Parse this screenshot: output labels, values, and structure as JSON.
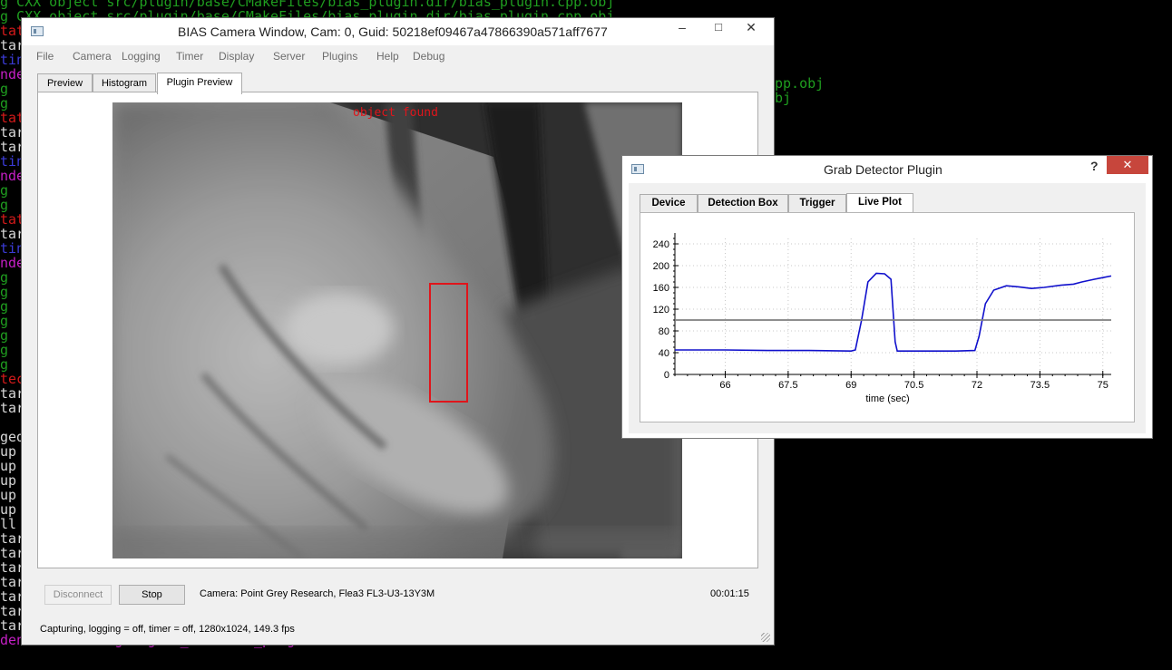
{
  "terminal": {
    "lines": [
      {
        "text": "g CXX object src/plugin/base/CMakeFiles/bias_plugin.dir/bias_plugin.cpp.obj",
        "cls": "tg"
      },
      {
        "text": "g CXX object src/plugin/base/CMakeFiles/bias_plugin.dir/bias_plugin.cpp.obj",
        "cls": "tg"
      },
      {
        "text": "tat",
        "cls": "tr"
      },
      {
        "text": "tar",
        "cls": "tw"
      },
      {
        "text": "tin",
        "cls": "tb"
      },
      {
        "text": "nde",
        "cls": "tm"
      },
      {
        "text": "g",
        "cls": "tg"
      },
      {
        "text": "g",
        "cls": "tg"
      },
      {
        "text": "tat",
        "cls": "tr"
      },
      {
        "text": "tar",
        "cls": "tw"
      },
      {
        "text": "tar",
        "cls": "tw"
      },
      {
        "text": "tin",
        "cls": "tb"
      },
      {
        "text": "nde",
        "cls": "tm"
      },
      {
        "text": "g",
        "cls": "tg"
      },
      {
        "text": "g",
        "cls": "tg"
      },
      {
        "text": "tat",
        "cls": "tr"
      },
      {
        "text": "tar",
        "cls": "tw"
      },
      {
        "text": "tin",
        "cls": "tb"
      },
      {
        "text": "nde",
        "cls": "tm"
      },
      {
        "text": "g",
        "cls": "tg"
      },
      {
        "text": "g",
        "cls": "tg"
      },
      {
        "text": "g",
        "cls": "tg"
      },
      {
        "text": "g",
        "cls": "tg"
      },
      {
        "text": "g",
        "cls": "tg"
      },
      {
        "text": "g",
        "cls": "tg"
      },
      {
        "text": "g",
        "cls": "tg"
      },
      {
        "text": "tec",
        "cls": "tr"
      },
      {
        "text": "tar",
        "cls": "tw"
      },
      {
        "text": "tar",
        "cls": "tw"
      },
      {
        "text": "",
        "cls": "tw"
      },
      {
        "text": "ged",
        "cls": "tw"
      },
      {
        "text": "up",
        "cls": "tw"
      },
      {
        "text": "up",
        "cls": "tw"
      },
      {
        "text": "up",
        "cls": "tw"
      },
      {
        "text": "up",
        "cls": "tw"
      },
      {
        "text": "up",
        "cls": "tw"
      },
      {
        "text": "ll",
        "cls": "tw"
      },
      {
        "text": "tar",
        "cls": "tw"
      },
      {
        "text": "tar",
        "cls": "tw"
      },
      {
        "text": "tar",
        "cls": "tw"
      },
      {
        "text": "tar",
        "cls": "tw"
      },
      {
        "text": "tar",
        "cls": "tw"
      },
      {
        "text": "tar",
        "cls": "tw"
      },
      {
        "text": "target qcustomplot",
        "cls": "tw"
      },
      {
        "text": "dencies of target grab_detector_plugin",
        "cls": "tm"
      }
    ],
    "side_lines": [
      {
        "text": "pp.obj",
        "cls": "tg"
      },
      {
        "text": "bj",
        "cls": "tg"
      }
    ]
  },
  "camera_window": {
    "title": "BIAS Camera Window, Cam: 0, Guid: 50218ef09467a47866390a571aff7677",
    "menu": [
      "File",
      "Camera",
      "Logging",
      "Timer",
      "Display",
      "Server",
      "Plugins",
      "Help",
      "Debug"
    ],
    "tabs": [
      "Preview",
      "Histogram",
      "Plugin Preview"
    ],
    "overlay_text": "object found",
    "overlay_color": "#e0151b",
    "buttons": {
      "disconnect": "Disconnect",
      "stop": "Stop"
    },
    "camera_info": "Camera:  Point Grey Research,  Flea3 FL3-U3-13Y3M",
    "elapsed": "00:01:15",
    "status": "Capturing, logging = off, timer = off, 1280x1024,  149.3 fps",
    "captions": {
      "minimize": "–",
      "maximize": "□",
      "close": "✕"
    }
  },
  "grab_window": {
    "title": "Grab Detector Plugin",
    "help": "?",
    "close": "✕",
    "tabs": [
      "Device",
      "Detection Box",
      "Trigger",
      "Live Plot"
    ]
  },
  "chart_data": {
    "type": "line",
    "title": "",
    "xlabel": "time (sec)",
    "ylabel": "",
    "xlim": [
      64.8,
      75.2
    ],
    "ylim": [
      0,
      250
    ],
    "xticks": [
      66,
      67.5,
      69,
      70.5,
      72,
      73.5,
      75
    ],
    "xtick_labels": [
      "66",
      "67.5",
      "69",
      "70.5",
      "72",
      "73.5",
      "75"
    ],
    "yticks": [
      0,
      40,
      80,
      120,
      160,
      200,
      240
    ],
    "grid": true,
    "series": [
      {
        "color": "#1010cc",
        "x": [
          64.8,
          66.0,
          67.0,
          68.0,
          69.0,
          69.1,
          69.25,
          69.4,
          69.6,
          69.8,
          69.95,
          70.05,
          70.1,
          70.5,
          71.0,
          71.5,
          71.95,
          72.05,
          72.2,
          72.4,
          72.7,
          73.0,
          73.3,
          73.6,
          74.0,
          74.3,
          74.5,
          74.8,
          75.0,
          75.2
        ],
        "y": [
          45,
          45,
          44,
          44,
          43,
          45,
          100,
          170,
          186,
          185,
          175,
          60,
          43,
          43,
          43,
          43,
          44,
          70,
          130,
          155,
          163,
          161,
          158,
          160,
          164,
          166,
          170,
          175,
          178,
          181
        ]
      },
      {
        "color": "#7f7f7f",
        "x": [
          64.8,
          75.2
        ],
        "y": [
          100,
          100
        ]
      }
    ]
  }
}
